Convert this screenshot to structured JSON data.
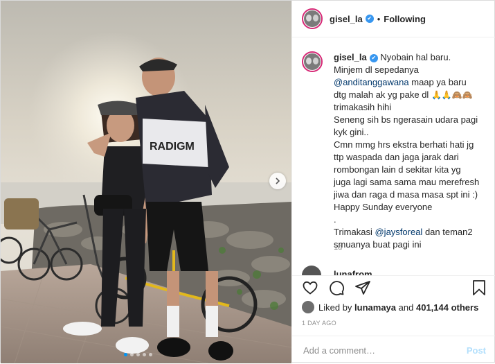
{
  "post": {
    "username": "gisel_la",
    "verified_badge": "✔",
    "follow_status": "Following",
    "separator": "•",
    "caption_lines": [
      "Nyobain hal baru.",
      "Minjem dl sepedanya",
      "@anditanggawana",
      "maap ya baru",
      "dtg malah ak yg pake dl",
      "🙏🙏🙈🙈",
      "trimakasih hihi",
      "Seneng sih bs ngerasain udara pagi",
      "kyk gini..",
      "Cmn mmg hrs ekstra berhati hati jg",
      "ttp waspada dan jaga jarak dari",
      "rombongan lain d sekitar kita yg",
      "juga lagi sama sama mau merefresh",
      "jiwa dan raga d masa masa spt ini :)",
      "Happy Sunday everyone",
      ".",
      "Trimakasi",
      "@jaysforeal",
      "dan teman2",
      "smuanya buat pagi ini"
    ],
    "caption_time": "1d",
    "next_comment_user": "lunafrom...",
    "likes": {
      "prefix": "Liked by",
      "user": "lunamaya",
      "and": "and",
      "count": "401,144 others"
    },
    "date": "1 DAY AGO",
    "comment_placeholder": "Add a comment…",
    "post_label": "Post",
    "photo_dots": 5,
    "active_dot": 0
  },
  "icons": {
    "like": "heart-icon",
    "comment": "comment-icon",
    "share": "share-icon",
    "save": "bookmark-icon",
    "next": "chevron-right-icon",
    "more": "more-icon"
  },
  "colors": {
    "link": "#00376b",
    "verified": "#3897f0",
    "post_disabled": "#b2dffc",
    "muted": "#8e8e8e"
  }
}
